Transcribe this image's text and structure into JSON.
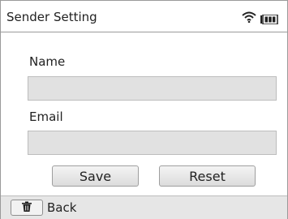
{
  "header": {
    "title": "Sender Setting",
    "wifi_icon": "wifi-icon",
    "battery_icon": "battery-icon"
  },
  "form": {
    "name_label": "Name",
    "name_value": "",
    "email_label": "Email",
    "email_value": ""
  },
  "buttons": {
    "save_label": "Save",
    "reset_label": "Reset"
  },
  "footer": {
    "back_icon": "trash-icon",
    "back_label": "Back"
  },
  "colors": {
    "field_fill": "#e1e1e1",
    "footer_fill": "#e6e6e6"
  }
}
